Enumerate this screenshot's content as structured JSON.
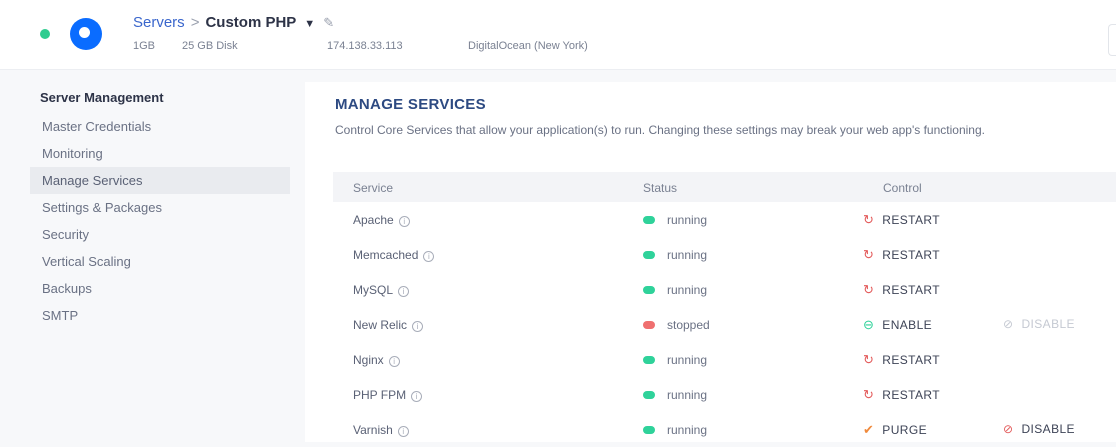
{
  "header": {
    "breadcrumb_root": "Servers",
    "breadcrumb_sep": ">",
    "breadcrumb_current": "Custom PHP",
    "caret": "▼",
    "edit": "✎",
    "ram": "1GB",
    "disk": "25 GB Disk",
    "ip": "174.138.33.113",
    "provider": "DigitalOcean (New York)"
  },
  "sidebar": {
    "title": "Server Management",
    "items": [
      {
        "label": "Master Credentials"
      },
      {
        "label": "Monitoring"
      },
      {
        "label": "Manage Services"
      },
      {
        "label": "Settings & Packages"
      },
      {
        "label": "Security"
      },
      {
        "label": "Vertical Scaling"
      },
      {
        "label": "Backups"
      },
      {
        "label": "SMTP"
      }
    ]
  },
  "main": {
    "title": "MANAGE SERVICES",
    "description": "Control Core Services that allow your application(s) to run. Changing these settings may break your web app's functioning.",
    "columns": [
      "Service",
      "Status",
      "Control"
    ],
    "rows": [
      {
        "service": "Apache",
        "status": "running",
        "control": "RESTART"
      },
      {
        "service": "Memcached",
        "status": "running",
        "control": "RESTART"
      },
      {
        "service": "MySQL",
        "status": "running",
        "control": "RESTART"
      },
      {
        "service": "New Relic",
        "status": "stopped",
        "control": "ENABLE",
        "control2": "DISABLE"
      },
      {
        "service": "Nginx",
        "status": "running",
        "control": "RESTART"
      },
      {
        "service": "PHP FPM",
        "status": "running",
        "control": "RESTART"
      },
      {
        "service": "Varnish",
        "status": "running",
        "control": "PURGE",
        "control2": "DISABLE"
      }
    ]
  },
  "colors": {
    "running": "#2fd29a",
    "stopped": "#ef6f6f",
    "accent": "#0a6cff"
  }
}
